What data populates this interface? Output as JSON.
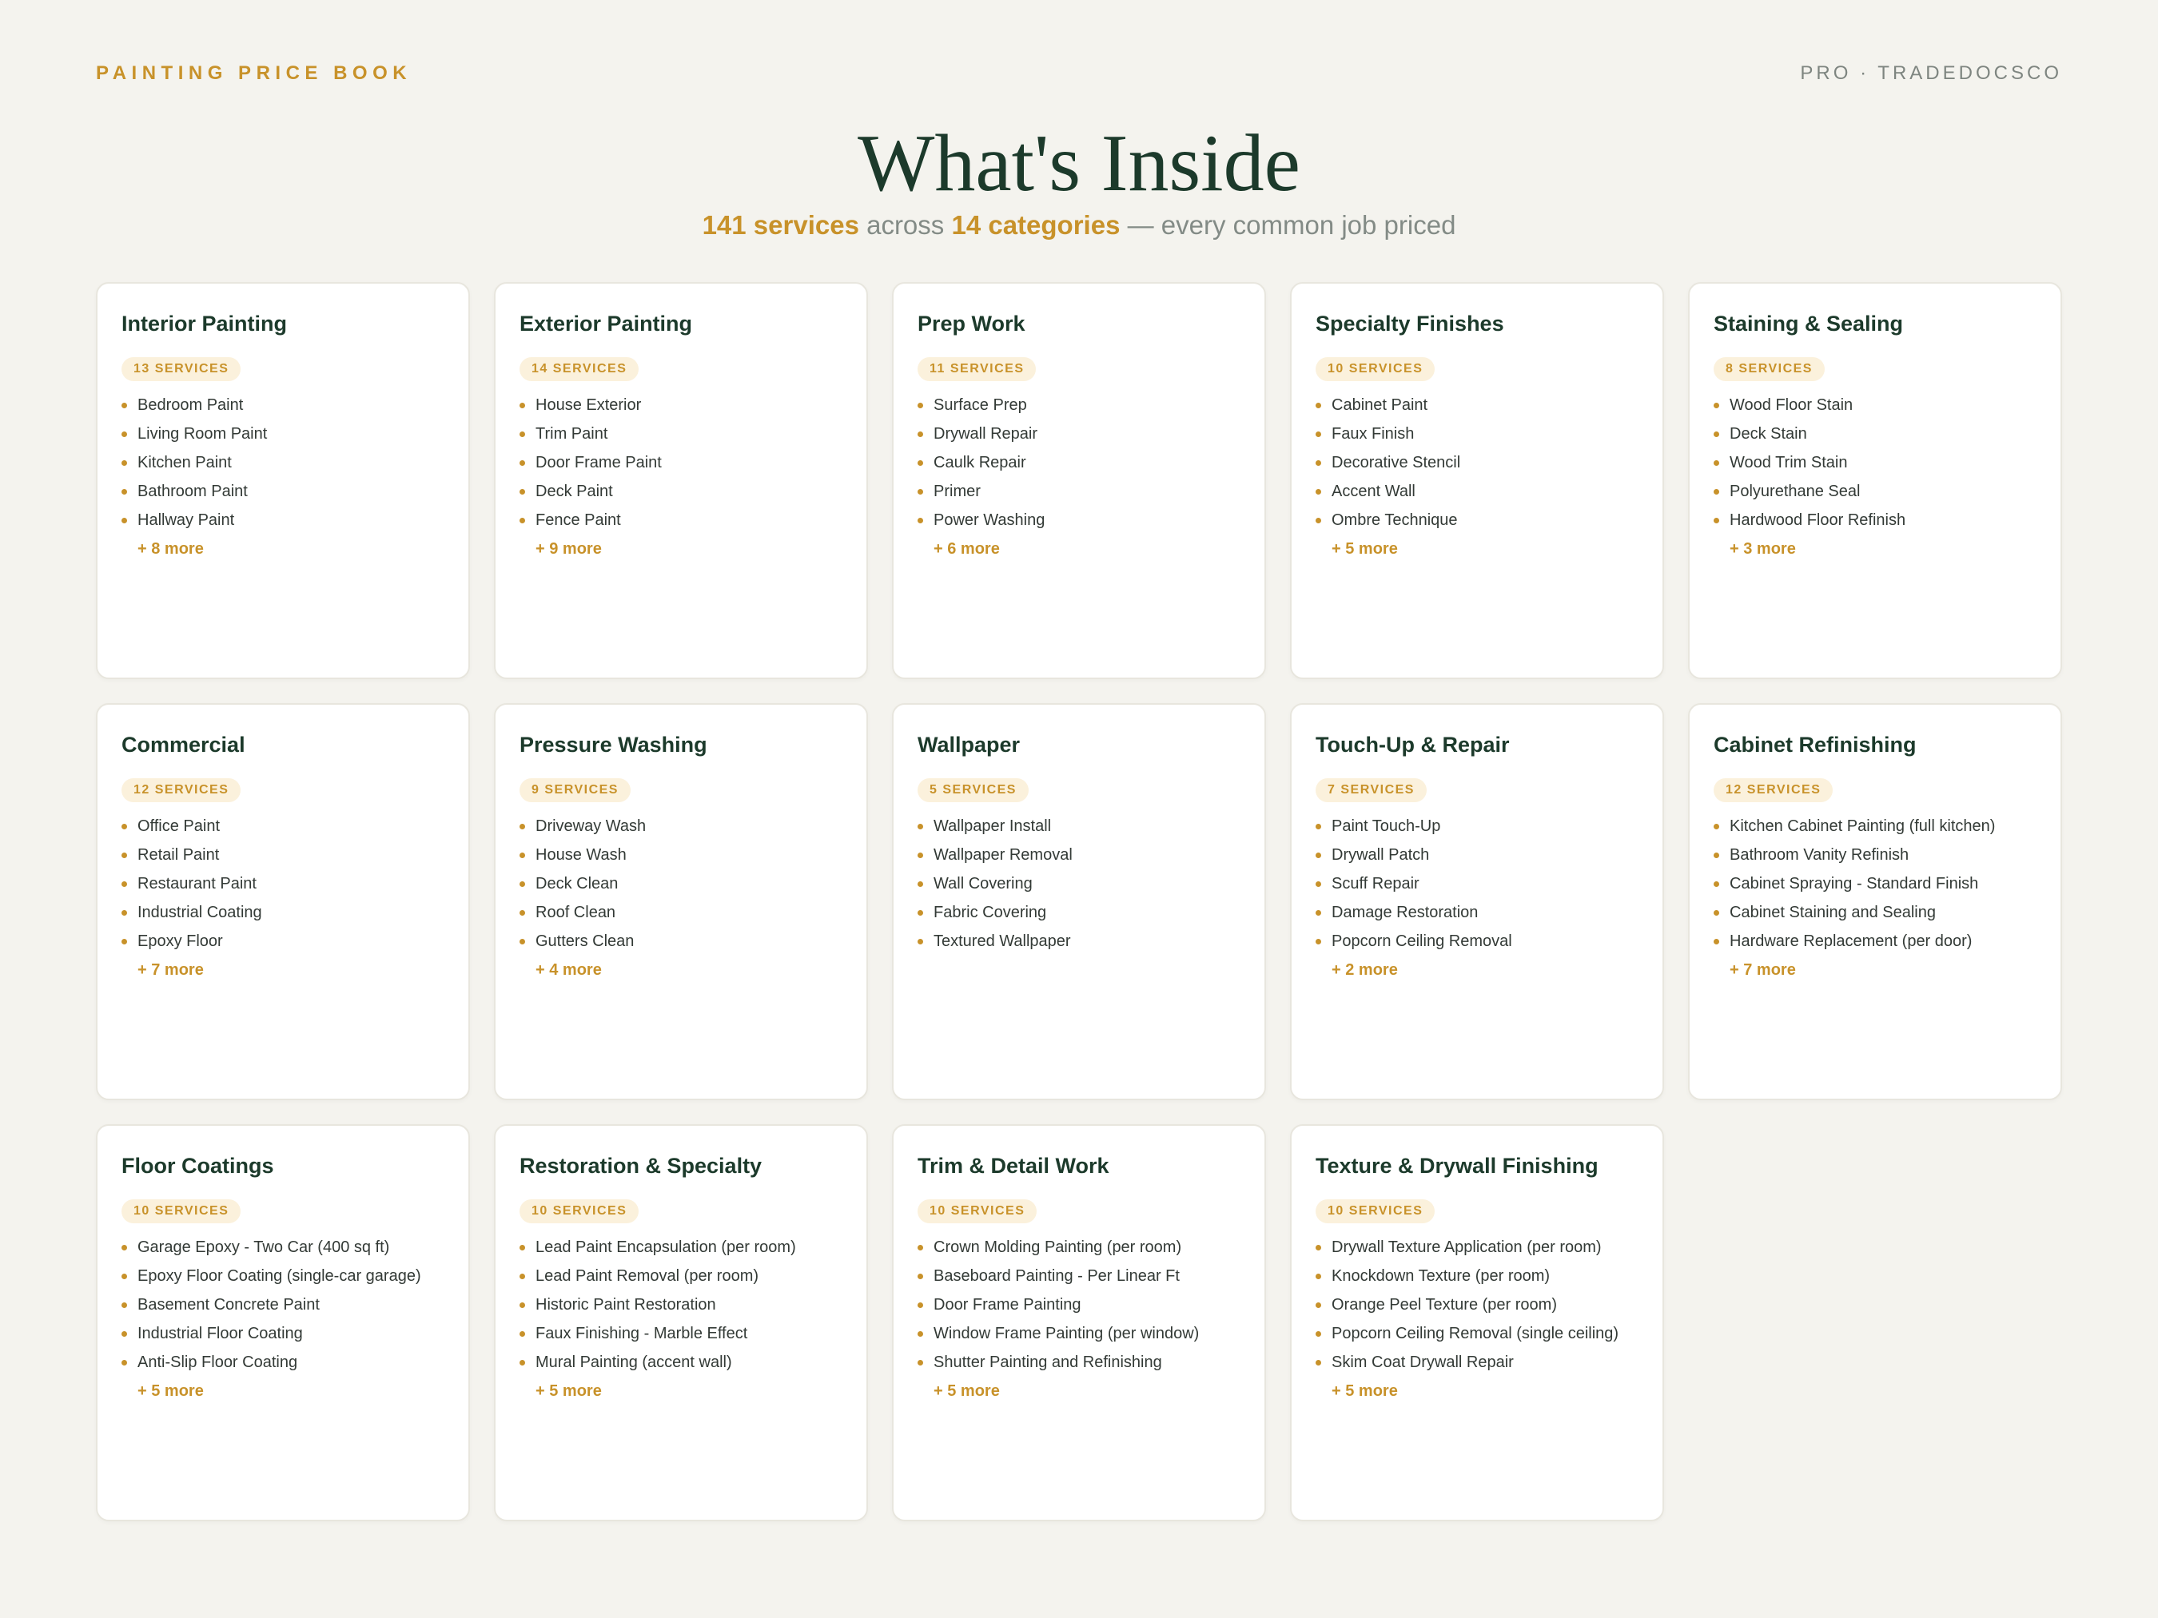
{
  "header": {
    "left_label": "PAINTING PRICE BOOK",
    "right_label": "PRO · TRADEDOCSCO",
    "title": "What's Inside",
    "subtitle": {
      "services": "141 services",
      "across": " across ",
      "categories": "14 categories",
      "rest": " — every common job priced"
    }
  },
  "accent_color": "#c8922a",
  "title_color": "#1c3a2b",
  "categories": [
    {
      "name": "Interior Painting",
      "badge": "13 SERVICES",
      "items": [
        "Bedroom Paint",
        "Living Room Paint",
        "Kitchen Paint",
        "Bathroom Paint",
        "Hallway Paint"
      ],
      "more": "+ 8 more"
    },
    {
      "name": "Exterior Painting",
      "badge": "14 SERVICES",
      "items": [
        "House Exterior",
        "Trim Paint",
        "Door Frame Paint",
        "Deck Paint",
        "Fence Paint"
      ],
      "more": "+ 9 more"
    },
    {
      "name": "Prep Work",
      "badge": "11 SERVICES",
      "items": [
        "Surface Prep",
        "Drywall Repair",
        "Caulk Repair",
        "Primer",
        "Power Washing"
      ],
      "more": "+ 6 more"
    },
    {
      "name": "Specialty Finishes",
      "badge": "10 SERVICES",
      "items": [
        "Cabinet Paint",
        "Faux Finish",
        "Decorative Stencil",
        "Accent Wall",
        "Ombre Technique"
      ],
      "more": "+ 5 more"
    },
    {
      "name": "Staining & Sealing",
      "badge": "8 SERVICES",
      "items": [
        "Wood Floor Stain",
        "Deck Stain",
        "Wood Trim Stain",
        "Polyurethane Seal",
        "Hardwood Floor Refinish"
      ],
      "more": "+ 3 more"
    },
    {
      "name": "Commercial",
      "badge": "12 SERVICES",
      "items": [
        "Office Paint",
        "Retail Paint",
        "Restaurant Paint",
        "Industrial Coating",
        "Epoxy Floor"
      ],
      "more": "+ 7 more"
    },
    {
      "name": "Pressure Washing",
      "badge": "9 SERVICES",
      "items": [
        "Driveway Wash",
        "House Wash",
        "Deck Clean",
        "Roof Clean",
        "Gutters Clean"
      ],
      "more": "+ 4 more"
    },
    {
      "name": "Wallpaper",
      "badge": "5 SERVICES",
      "items": [
        "Wallpaper Install",
        "Wallpaper Removal",
        "Wall Covering",
        "Fabric Covering",
        "Textured Wallpaper"
      ],
      "more": ""
    },
    {
      "name": "Touch-Up & Repair",
      "badge": "7 SERVICES",
      "items": [
        "Paint Touch-Up",
        "Drywall Patch",
        "Scuff Repair",
        "Damage Restoration",
        "Popcorn Ceiling Removal"
      ],
      "more": "+ 2 more"
    },
    {
      "name": "Cabinet Refinishing",
      "badge": "12 SERVICES",
      "items": [
        "Kitchen Cabinet Painting (full kitchen)",
        "Bathroom Vanity Refinish",
        "Cabinet Spraying - Standard Finish",
        "Cabinet Staining and Sealing",
        "Hardware Replacement (per door)"
      ],
      "more": "+ 7 more"
    },
    {
      "name": "Floor Coatings",
      "badge": "10 SERVICES",
      "items": [
        "Garage Epoxy - Two Car (400 sq ft)",
        "Epoxy Floor Coating (single-car garage)",
        "Basement Concrete Paint",
        "Industrial Floor Coating",
        "Anti-Slip Floor Coating"
      ],
      "more": "+ 5 more"
    },
    {
      "name": "Restoration & Specialty",
      "badge": "10 SERVICES",
      "items": [
        "Lead Paint Encapsulation (per room)",
        "Lead Paint Removal (per room)",
        "Historic Paint Restoration",
        "Faux Finishing - Marble Effect",
        "Mural Painting (accent wall)"
      ],
      "more": "+ 5 more"
    },
    {
      "name": "Trim & Detail Work",
      "badge": "10 SERVICES",
      "items": [
        "Crown Molding Painting (per room)",
        "Baseboard Painting - Per Linear Ft",
        "Door Frame Painting",
        "Window Frame Painting (per window)",
        "Shutter Painting and Refinishing"
      ],
      "more": "+ 5 more"
    },
    {
      "name": "Texture & Drywall Finishing",
      "badge": "10 SERVICES",
      "items": [
        "Drywall Texture Application (per room)",
        "Knockdown Texture (per room)",
        "Orange Peel Texture (per room)",
        "Popcorn Ceiling Removal (single ceiling)",
        "Skim Coat Drywall Repair"
      ],
      "more": "+ 5 more"
    }
  ]
}
